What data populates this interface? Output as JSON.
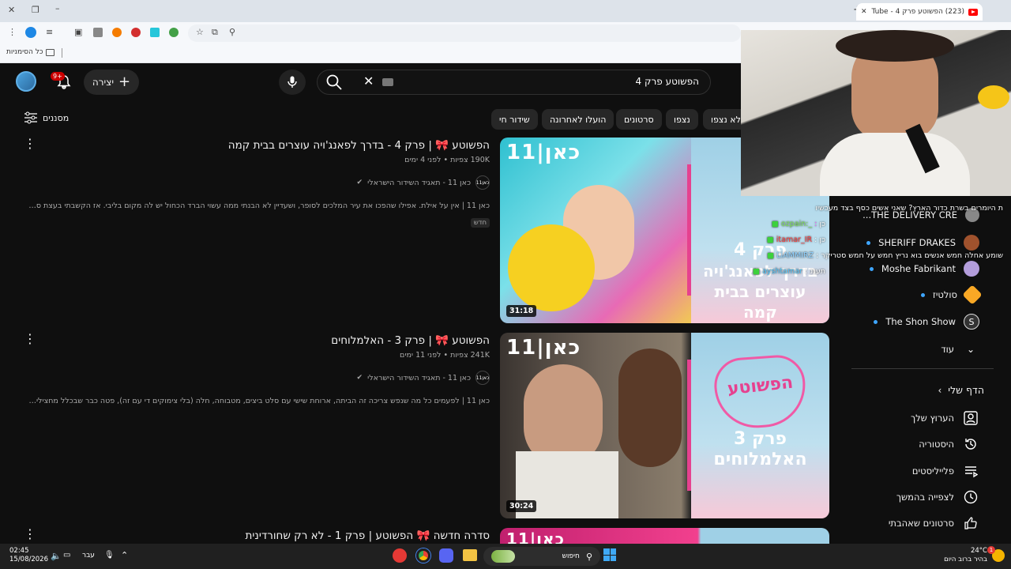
{
  "browser": {
    "tab_title": "(223) הפשוטע פרק 4 - YouTube",
    "bookmarks_label": "כל הסימניות"
  },
  "youtube": {
    "search_query": "הפשוטע פרק 4",
    "create_label": "יצירה",
    "notif_count": "9+",
    "filters_label": "מסננים",
    "chips": [
      "לא נצפו",
      "נצפו",
      "סרטונים",
      "הועלו לאחרונה",
      "שידור חי"
    ],
    "videos": [
      {
        "title": "הפשוטע 🎀 | פרק 4 - בדרך לפאנג'ויה עוצרים בבית קמה",
        "meta": "190K צפיות • לפני 4 ימים",
        "channel": "כאן 11 - תאגיד השידור הישראלי",
        "channel_avatar": "כאן11",
        "description": "כאן 11 | אין על אילת. אפילו שהפכו את עיר המלכים לסופר, ושעדיין לא הבנתי ממה עשוי הברד הכחול יש לה מקום בליבי. אז הקשבתי בעצת סבתא סימי ...",
        "badge": "חדש",
        "duration": "31:18",
        "thumb_line1": "פרק 4",
        "thumb_line2": "בדרך לפאנג'ויה",
        "thumb_line3": "עוצרים בבית",
        "thumb_line4": "קמה",
        "kan_logo": "כאן|11"
      },
      {
        "title": "הפשוטע 🎀 | פרק 3 - האלמלוחים",
        "meta": "241K צפיות • לפני 11 ימים",
        "channel": "כאן 11 - תאגיד השידור הישראלי",
        "channel_avatar": "כאן11",
        "description": "כאן 11 | לפעמים כל מה שנפש צריכה זה הביתה, ארוחת שישי עם סלט ביצים, מטבוחה, חלה (בלי צימוקים די עם זה), פטה כבר שבכלל מחצילים, אבוקדו ...",
        "duration": "30:24",
        "thumb_line1": "פרק 3",
        "thumb_line2": "האלמלוחים",
        "show_logo": "הפשוטע",
        "kan_logo": "כאן|11"
      },
      {
        "title": "סדרה חדשה 🎀 הפשוטע | פרק 1 - לא רק שחורדינית",
        "kan_logo": "כאן|11"
      }
    ],
    "sidebar": {
      "subs": [
        {
          "name": "THE DELIVERY CRE..."
        },
        {
          "name": "SHERIFF DRAKES"
        },
        {
          "name": "Moshe Fabrikant"
        },
        {
          "name": "סולטיז"
        },
        {
          "name": "The Shon Show"
        }
      ],
      "more_label": "עוד",
      "you_label": "הדף שלי",
      "items": [
        {
          "label": "הערוץ שלך",
          "icon": "person-icon"
        },
        {
          "label": "היסטוריה",
          "icon": "history-icon"
        },
        {
          "label": "פלייליסטים",
          "icon": "playlist-icon"
        },
        {
          "label": "לצפייה בהמשך",
          "icon": "clock-icon"
        },
        {
          "label": "סרטונים שאהבתי",
          "icon": "thumbs-up-icon"
        }
      ]
    }
  },
  "stream_overlay": {
    "chat": [
      {
        "user": "בשרה",
        "text": "ת היומרים בשרת כדור הארץ? שאני אשים כסף בצד מעכשיו"
      },
      {
        "user": "_:ozpain",
        "text": "כן"
      },
      {
        "user": "itamar_IR",
        "text": "כן"
      },
      {
        "user": "LIAMMIRZ",
        "text": "שומע אחלה חמש אנשים בוא נריץ חמש על חמש סטריקר"
      },
      {
        "user": "ayshtamar",
        "text": "תעננ"
      }
    ]
  },
  "taskbar": {
    "time": "02:45",
    "date": "15/08/2026",
    "lang": "עבר",
    "search_label": "חיפוש",
    "weather_temp": "24°C",
    "weather_desc": "בהיר ברוב היום",
    "weather_badge": "1"
  }
}
